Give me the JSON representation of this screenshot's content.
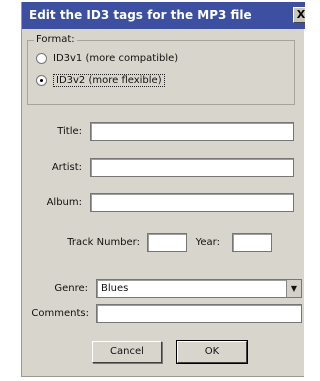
{
  "dialog": {
    "title": "Edit the ID3 tags for the MP3 file",
    "close_glyph": "X"
  },
  "format": {
    "legend": "Format:",
    "options": [
      {
        "label": "ID3v1 (more compatible)",
        "selected": false
      },
      {
        "label": "ID3v2 (more flexible)",
        "selected": true
      }
    ]
  },
  "fields": {
    "title_label": "Title:",
    "title_value": "",
    "artist_label": "Artist:",
    "artist_value": "",
    "album_label": "Album:",
    "album_value": "",
    "track_label": "Track Number:",
    "track_value": "",
    "year_label": "Year:",
    "year_value": "",
    "genre_label": "Genre:",
    "genre_value": "Blues",
    "comments_label": "Comments:",
    "comments_value": ""
  },
  "buttons": {
    "cancel": "Cancel",
    "ok": "OK"
  },
  "icons": {
    "dropdown": "chevron-down-icon",
    "close": "close-icon"
  }
}
